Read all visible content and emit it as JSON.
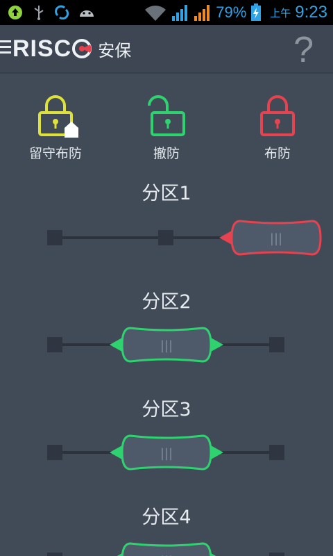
{
  "status_bar": {
    "battery_percent": "79%",
    "ampm": "上午",
    "time": "9:23",
    "icons": [
      "upload-icon",
      "usb-icon",
      "sync-icon",
      "android-icon",
      "wifi-icon",
      "signal-icon",
      "signal-icon-2",
      "battery-charging-icon"
    ]
  },
  "header": {
    "brand": "RISC",
    "title": "安保",
    "help": "?"
  },
  "modes": [
    {
      "label": "留守布防",
      "color": "#dde13a",
      "state": "stay-armed"
    },
    {
      "label": "撤防",
      "color": "#2ed36f",
      "state": "disarmed"
    },
    {
      "label": "布防",
      "color": "#e4434f",
      "state": "armed"
    }
  ],
  "partitions": [
    {
      "title": "分区1",
      "state": "armed",
      "slider_position": "right",
      "color": "#e4434f"
    },
    {
      "title": "分区2",
      "state": "disarmed",
      "slider_position": "center",
      "color": "#2ed36f"
    },
    {
      "title": "分区3",
      "state": "disarmed",
      "slider_position": "center",
      "color": "#2ed36f"
    },
    {
      "title": "分区4",
      "state": "disarmed",
      "slider_position": "center",
      "color": "#2ed36f"
    }
  ],
  "handle_grip": "|||",
  "colors": {
    "background": "#414b57",
    "header": "#3d4652",
    "status_bar": "#000000",
    "status_accent": "#2fa3e6"
  }
}
